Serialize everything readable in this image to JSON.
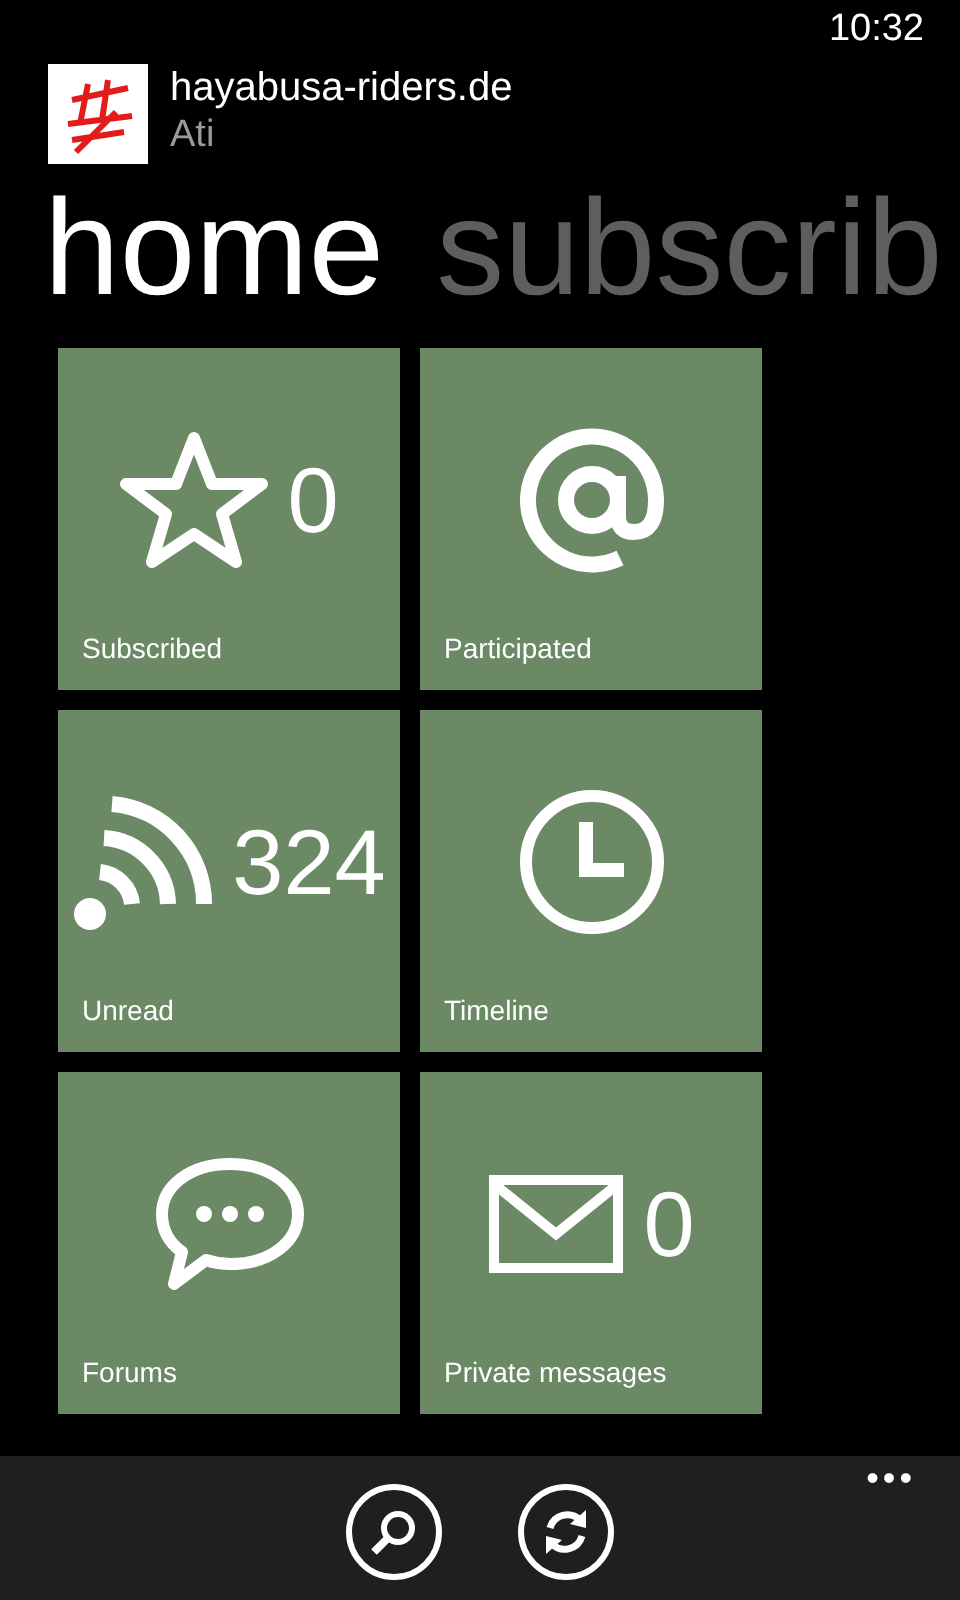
{
  "status_bar": {
    "time": "10:32"
  },
  "header": {
    "site": "hayabusa-riders.de",
    "user": "Ati"
  },
  "pivots": [
    {
      "label": "home",
      "selected": true
    },
    {
      "label": "subscrib",
      "selected": false
    }
  ],
  "tiles": [
    {
      "label": "Subscribed",
      "count": "0"
    },
    {
      "label": "Participated"
    },
    {
      "label": "Unread",
      "count": "324"
    },
    {
      "label": "Timeline"
    },
    {
      "label": "Forums"
    },
    {
      "label": "Private messages",
      "count": "0"
    }
  ],
  "app_bar": {
    "more": "•••"
  }
}
